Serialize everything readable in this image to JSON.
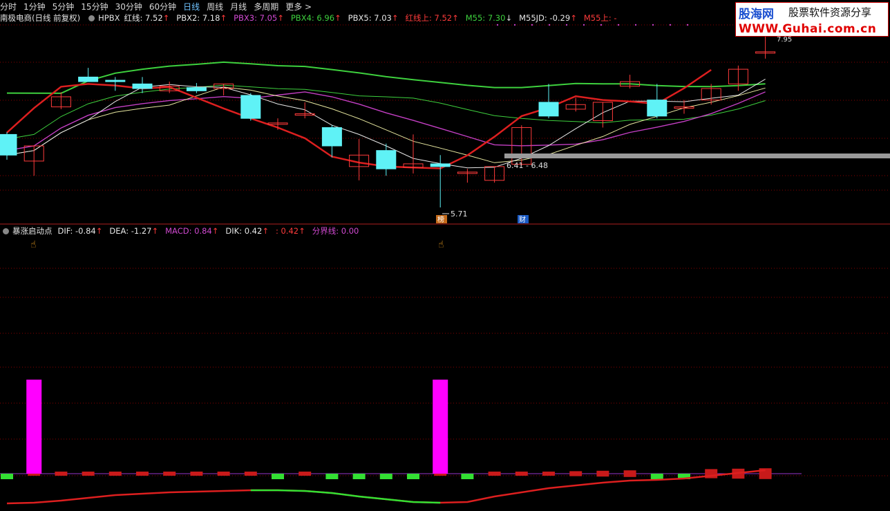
{
  "toolbar": {
    "tabs": [
      "分时",
      "1分钟",
      "5分钟",
      "15分钟",
      "30分钟",
      "60分钟",
      "日线",
      "周线",
      "月线",
      "多周期",
      "更多 >"
    ],
    "active": "日线"
  },
  "main_legend": {
    "title": "南极电商(日线 前复权)",
    "indicator": "HPBX",
    "items": [
      {
        "label": "红线: 7.52",
        "arrow": "↑",
        "color": "#e8e8e8"
      },
      {
        "label": "PBX2: 7.18",
        "arrow": "↑",
        "color": "#e8e8e8"
      },
      {
        "label": "PBX3: 7.05",
        "arrow": "↑",
        "color": "#d24ad2"
      },
      {
        "label": "PBX4: 6.96",
        "arrow": "↑",
        "color": "#3ed13e"
      },
      {
        "label": "PBX5: 7.03",
        "arrow": "↑",
        "color": "#e8e8e8"
      },
      {
        "label": "红线上: 7.52",
        "arrow": "↑",
        "color": "#ff3b3b"
      },
      {
        "label": "M55: 7.30",
        "arrow": "↓",
        "color": "#3ed13e"
      },
      {
        "label": "M55JD: -0.29",
        "arrow": "↑",
        "color": "#e8e8e8"
      },
      {
        "label": "M55上: -",
        "arrow": "",
        "color": "#ff3b3b"
      }
    ]
  },
  "sub_legend": {
    "title": "暴涨启动点",
    "items": [
      {
        "label": "DIF: -0.84",
        "arrow": "↑",
        "color": "#e8e8e8"
      },
      {
        "label": "DEA: -1.27",
        "arrow": "↑",
        "color": "#e8e8e8"
      },
      {
        "label": "MACD: 0.84",
        "arrow": "↑",
        "color": "#d24ad2"
      },
      {
        "label": "DIK: 0.42",
        "arrow": "↑",
        "color": "#e8e8e8"
      },
      {
        "label": ": 0.42",
        "arrow": "↑",
        "color": "#ff3b3b"
      },
      {
        "label": "分界线: 0.00",
        "arrow": "",
        "color": "#d24ad2"
      }
    ]
  },
  "annotations": {
    "range_label": "6.41 - 6.48",
    "low_label": "5.71",
    "high_label": "7.95",
    "tag1": "榜",
    "tag2": "财"
  },
  "logo": {
    "line1a": "股海网",
    "line1b": "股票软件资源分享",
    "line2": "WWW.Guhai.com.cn"
  },
  "chart_data": {
    "type": "candlestick",
    "candles": [
      {
        "o": 7.3,
        "h": 7.35,
        "l": 6.75,
        "c": 6.85
      },
      {
        "o": 6.72,
        "h": 7.05,
        "l": 6.4,
        "c": 7.05
      },
      {
        "o": 7.9,
        "h": 8.22,
        "l": 7.85,
        "c": 8.12
      },
      {
        "o": 8.55,
        "h": 8.75,
        "l": 8.45,
        "c": 8.45
      },
      {
        "o": 8.48,
        "h": 8.55,
        "l": 8.25,
        "c": 8.45
      },
      {
        "o": 8.4,
        "h": 8.55,
        "l": 8.2,
        "c": 8.3
      },
      {
        "o": 8.25,
        "h": 8.45,
        "l": 8.2,
        "c": 8.35
      },
      {
        "o": 8.32,
        "h": 8.42,
        "l": 8.2,
        "c": 8.25
      },
      {
        "o": 8.3,
        "h": 8.4,
        "l": 8.15,
        "c": 8.4
      },
      {
        "o": 8.15,
        "h": 8.2,
        "l": 7.6,
        "c": 7.65
      },
      {
        "o": 7.55,
        "h": 7.65,
        "l": 7.4,
        "c": 7.55
      },
      {
        "o": 7.72,
        "h": 8.0,
        "l": 7.65,
        "c": 7.75
      },
      {
        "o": 7.45,
        "h": 7.5,
        "l": 6.8,
        "c": 7.05
      },
      {
        "o": 6.6,
        "h": 7.2,
        "l": 6.3,
        "c": 6.85
      },
      {
        "o": 6.95,
        "h": 7.1,
        "l": 6.4,
        "c": 6.55
      },
      {
        "o": 6.58,
        "h": 7.3,
        "l": 6.45,
        "c": 6.66
      },
      {
        "o": 6.66,
        "h": 6.85,
        "l": 5.71,
        "c": 6.6
      },
      {
        "o": 6.48,
        "h": 6.55,
        "l": 6.25,
        "c": 6.48
      },
      {
        "o": 6.3,
        "h": 6.6,
        "l": 6.25,
        "c": 6.6
      },
      {
        "o": 6.65,
        "h": 7.5,
        "l": 6.62,
        "c": 7.45
      },
      {
        "o": 8.0,
        "h": 8.4,
        "l": 7.65,
        "c": 7.7
      },
      {
        "o": 7.85,
        "h": 8.1,
        "l": 7.8,
        "c": 7.95
      },
      {
        "o": 7.6,
        "h": 8.0,
        "l": 7.45,
        "c": 8.0
      },
      {
        "o": 8.35,
        "h": 8.6,
        "l": 8.3,
        "c": 8.45
      },
      {
        "o": 8.05,
        "h": 8.4,
        "l": 7.65,
        "c": 7.7
      },
      {
        "o": 7.9,
        "h": 8.05,
        "l": 7.75,
        "c": 7.9
      },
      {
        "o": 8.05,
        "h": 8.4,
        "l": 7.95,
        "c": 8.3
      },
      {
        "o": 8.4,
        "h": 8.8,
        "l": 8.25,
        "c": 8.72
      },
      {
        "o": 9.1,
        "h": 9.55,
        "l": 8.95,
        "c": 9.1
      }
    ],
    "sub_bars": [
      {
        "kind": "green",
        "v": 1
      },
      {
        "kind": "red",
        "v": 1
      },
      {
        "kind": "red",
        "v": 1
      },
      {
        "kind": "red",
        "v": 1
      },
      {
        "kind": "red",
        "v": 1
      },
      {
        "kind": "red",
        "v": 1
      },
      {
        "kind": "red",
        "v": 1
      },
      {
        "kind": "red",
        "v": 1
      },
      {
        "kind": "red",
        "v": 1
      },
      {
        "kind": "red",
        "v": 1
      },
      {
        "kind": "green",
        "v": 1
      },
      {
        "kind": "red",
        "v": 1
      },
      {
        "kind": "green",
        "v": 1
      },
      {
        "kind": "green",
        "v": 1
      },
      {
        "kind": "green",
        "v": 1
      },
      {
        "kind": "green",
        "v": 1
      },
      {
        "kind": "red",
        "v": 1
      },
      {
        "kind": "green",
        "v": 1
      },
      {
        "kind": "red",
        "v": 1
      },
      {
        "kind": "red",
        "v": 1
      },
      {
        "kind": "red",
        "v": 1
      },
      {
        "kind": "red",
        "v": 1
      },
      {
        "kind": "red",
        "v": 1
      },
      {
        "kind": "red",
        "v": 1
      },
      {
        "kind": "green",
        "v": 1
      },
      {
        "kind": "green",
        "v": 1
      },
      {
        "kind": "red",
        "v": 1
      },
      {
        "kind": "red",
        "v": 1
      },
      {
        "kind": "red",
        "v": 1
      }
    ],
    "spikes": [
      1,
      16
    ],
    "colors": {
      "up": "#ff3b3b",
      "down": "#5ff2f6",
      "grid": "#8b0000",
      "ma_green": "#3ed13e",
      "ma_purple": "#c43fc4",
      "ma_white": "#e8e8e8",
      "ma_yellow": "#e8e8a0",
      "red_line": "#dd1f1f",
      "spike": "#ff00ff"
    }
  }
}
